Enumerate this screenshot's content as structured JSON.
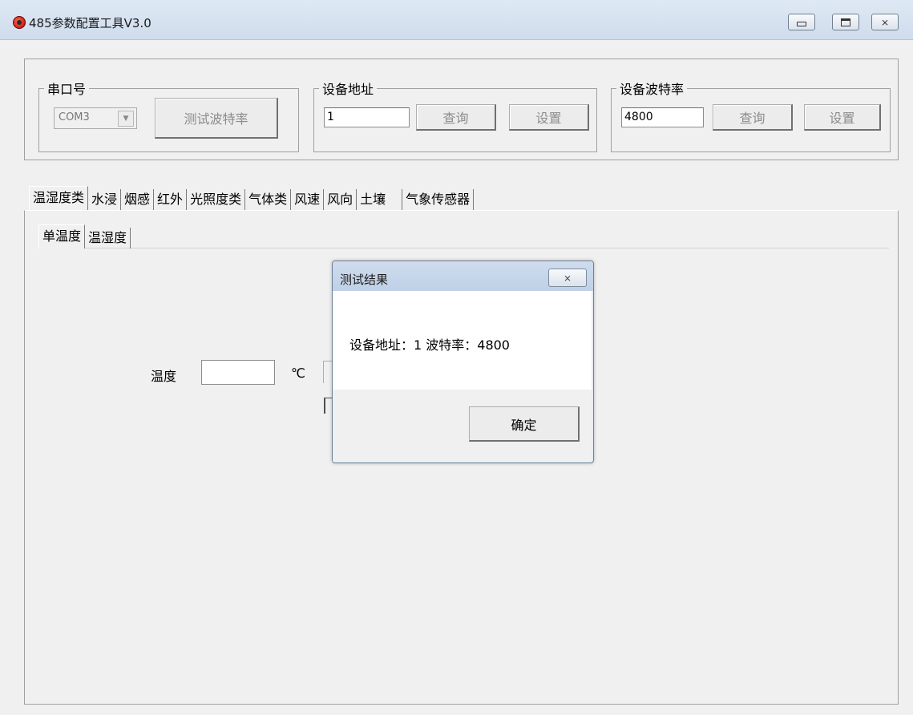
{
  "window": {
    "title": "485参数配置工具V3.0",
    "controls": {
      "minimize_icon": "minimize-icon",
      "maximize_icon": "maximize-icon",
      "close_icon": "close-icon",
      "close_glyph": "⨯"
    }
  },
  "serial": {
    "legend": "串口号",
    "port_value": "COM3",
    "test_baud_button": "测试波特率"
  },
  "address": {
    "legend": "设备地址",
    "value": "1",
    "query_button": "查询",
    "set_button": "设置"
  },
  "baud": {
    "legend": "设备波特率",
    "value": "4800",
    "query_button": "查询",
    "set_button": "设置"
  },
  "main_tabs": [
    {
      "label": "温湿度类"
    },
    {
      "label": "水浸"
    },
    {
      "label": "烟感"
    },
    {
      "label": "红外"
    },
    {
      "label": "光照度类"
    },
    {
      "label": "气体类"
    },
    {
      "label": "风速"
    },
    {
      "label": "风向"
    },
    {
      "label": "土壤"
    },
    {
      "label": "气象传感器"
    }
  ],
  "sub_tabs": [
    {
      "label": "单温度"
    },
    {
      "label": "温湿度"
    }
  ],
  "temperature": {
    "label": "温度",
    "unit": "℃",
    "value": ""
  },
  "dialog": {
    "title": "测试结果",
    "message": "设备地址：1  波特率：4800",
    "ok_button": "确定",
    "close_icon": "close-icon",
    "close_glyph": "⨯"
  }
}
